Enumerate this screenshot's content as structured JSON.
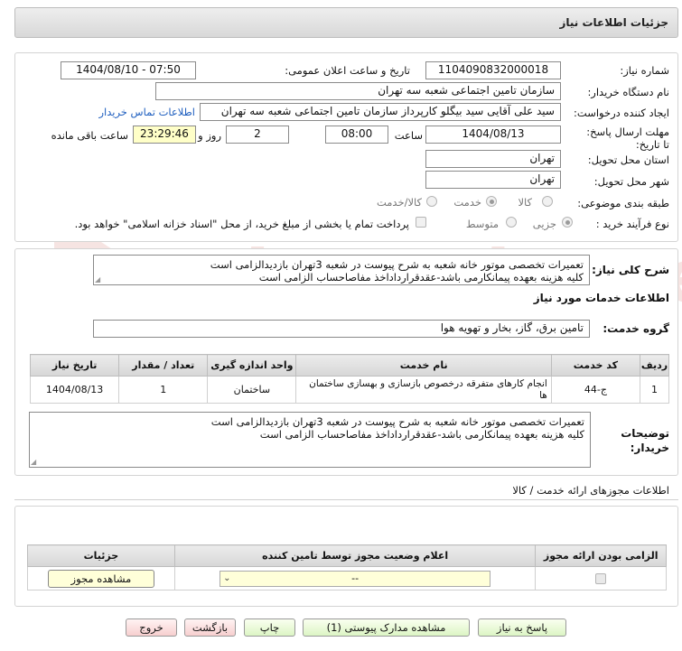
{
  "header": {
    "title": "جزئیات اطلاعات نیاز"
  },
  "form": {
    "need_number_label": "شماره نیاز:",
    "need_number": "1104090832000018",
    "announce_label": "تاریخ و ساعت اعلان عمومی:",
    "announce_value": "1404/08/10 - 07:50",
    "buyer_org_label": "نام دستگاه خریدار:",
    "buyer_org": "سازمان تامین اجتماعی شعبه سه تهران",
    "requester_label": "ایجاد کننده درخواست:",
    "requester": "سید علی آقایی سید بیگلو کارپرداز سازمان تامین اجتماعی شعبه سه تهران",
    "contact_link": "اطلاعات تماس خریدار",
    "deadline_label": "مهلت ارسال پاسخ: تا تاریخ:",
    "deadline_date": "1404/08/13",
    "time_label": "ساعت",
    "deadline_time": "08:00",
    "days_value": "2",
    "days_label": "روز و",
    "remaining_time": "23:29:46",
    "remaining_label": "ساعت باقی مانده",
    "province_label": "استان محل تحویل:",
    "province": "تهران",
    "city_label": "شهر محل تحویل:",
    "city": "تهران",
    "category_label": "طبقه بندی موضوعی:",
    "category_options": [
      "کالا",
      "خدمت",
      "کالا/خدمت"
    ],
    "category_selected": "خدمت",
    "process_label": "نوع فرآیند خرید :",
    "process_options": [
      "جزیی",
      "متوسط"
    ],
    "process_selected": "جزیی",
    "payment_note": "پرداخت تمام یا بخشی از مبلغ خرید، از محل \"اسناد خزانه اسلامی\" خواهد بود."
  },
  "general": {
    "label": "شرح کلی نیاز:",
    "text": "تعمیرات تخصصی موتور خانه شعبه به شرح پیوست در شعبه 3تهران بازدیدالزامی است\nکلیه هزینه بعهده پیمانکارمی باشد-عقدقرارداداخذ مفاصاحساب الزامی است"
  },
  "services": {
    "section_title": "اطلاعات خدمات مورد نیاز",
    "group_label": "گروه خدمت:",
    "group_value": "تامین برق، گاز، بخار و تهویه هوا",
    "columns": [
      "ردیف",
      "کد خدمت",
      "نام خدمت",
      "واحد اندازه گیری",
      "تعداد / مقدار",
      "تاریخ نیاز"
    ],
    "rows": [
      [
        "1",
        "ج-44",
        "انجام کارهای متفرقه درخصوص بازسازی و بهسازی ساختمان ها",
        "ساختمان",
        "1",
        "1404/08/13"
      ]
    ]
  },
  "buyer_notes": {
    "label": "توضیحات خریدار:",
    "text": "تعمیرات تخصصی موتور خانه شعبه به شرح پیوست در شعبه 3تهران بازدیدالزامی است\nکلیه هزینه بعهده پیمانکارمی باشد-عقدقرارداداخذ مفاصاحساب الزامی است"
  },
  "permits": {
    "section_title": "اطلاعات مجوزهای ارائه خدمت / کالا",
    "columns": [
      "الزامی بودن ارائه مجوز",
      "اعلام وضعیت مجوز توسط تامین کننده",
      "جزئیات"
    ],
    "select_value": "--",
    "view_button": "مشاهده مجوز"
  },
  "actions": {
    "reply": "پاسخ به نیاز",
    "attachments": "مشاهده مدارک پیوستی (1)",
    "print": "چاپ",
    "back": "بازگشت",
    "exit": "خروج"
  },
  "watermark": {
    "text": "AriaTender.net"
  }
}
